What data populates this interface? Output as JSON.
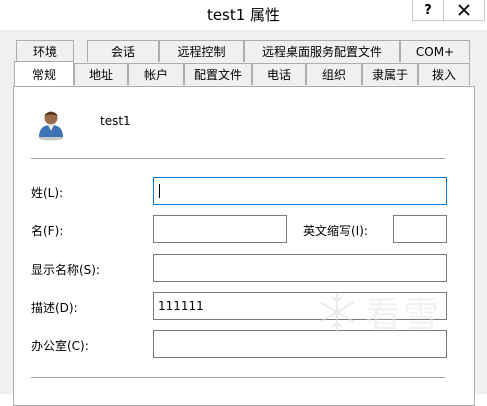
{
  "window": {
    "title": "test1 属性",
    "help_label": "?"
  },
  "tabs_back": [
    "环境",
    "会话",
    "远程控制",
    "远程桌面服务配置文件",
    "COM+"
  ],
  "tabs_front": [
    "常规",
    "地址",
    "帐户",
    "配置文件",
    "电话",
    "组织",
    "隶属于",
    "拨入"
  ],
  "active_tab": "常规",
  "user": {
    "name": "test1"
  },
  "fields": {
    "last_name_label": "姓(L):",
    "last_name_value": "",
    "first_name_label": "名(F):",
    "first_name_value": "",
    "initials_label": "英文缩写(I):",
    "initials_value": "",
    "display_name_label": "显示名称(S):",
    "display_name_value": "",
    "description_label": "描述(D):",
    "description_value": "111111",
    "office_label": "办公室(C):",
    "office_value": ""
  },
  "watermark": {
    "text": "看雪"
  }
}
